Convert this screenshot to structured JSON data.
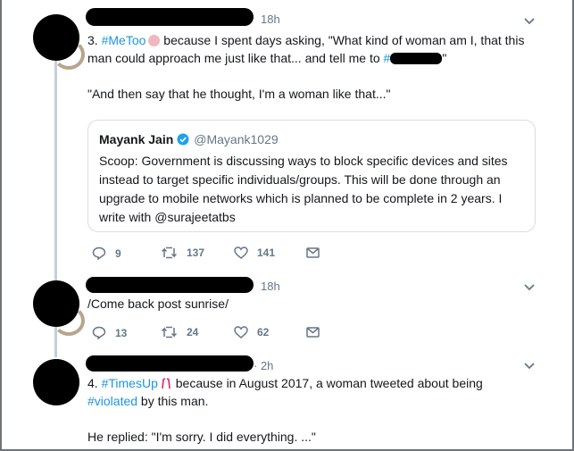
{
  "tweet1": {
    "time": "18h",
    "line1_prefix": "3. ",
    "hashtag": "#MeToo",
    "line1_rest": " because I spent days asking, \"What kind of woman am I, that this",
    "line2_text": "man could approach me just like that... and tell me to ",
    "line2_hash": "#",
    "line2_end": "\"",
    "line3": "\"And then say that he thought, I'm a woman like that...\"",
    "quote": {
      "name": "Mayank Jain",
      "handle": "@Mayank1029",
      "lines": [
        "Scoop: Government is discussing ways to block specific devices and sites",
        "instead to target specific individuals/groups. This will be done through an",
        "upgrade to mobile networks which is planned to be complete in 2 years. I",
        "write with @surajeetatbs"
      ]
    },
    "replies": "9",
    "retweets": "137",
    "likes": "141"
  },
  "tweet2": {
    "time": "18h",
    "text": "/Come back post sunrise/",
    "replies": "13",
    "retweets": "24",
    "likes": "62"
  },
  "tweet3": {
    "time": "· 2h",
    "line1_prefix": "4. ",
    "hashtag": "#TimesUp",
    "line1_rest": " because in August 2017, a woman tweeted about being",
    "line2_hash": "#violated",
    "line2_rest": " by this man.",
    "line3": "He replied: \"I'm sorry. I did everything. ...\""
  },
  "colors": {
    "link": "#1b95e0",
    "muted": "#657786",
    "verified": "#1da1f2"
  },
  "icons": [
    "reply-icon",
    "retweet-icon",
    "like-icon",
    "message-icon",
    "chevron-down-icon",
    "verified-icon"
  ]
}
